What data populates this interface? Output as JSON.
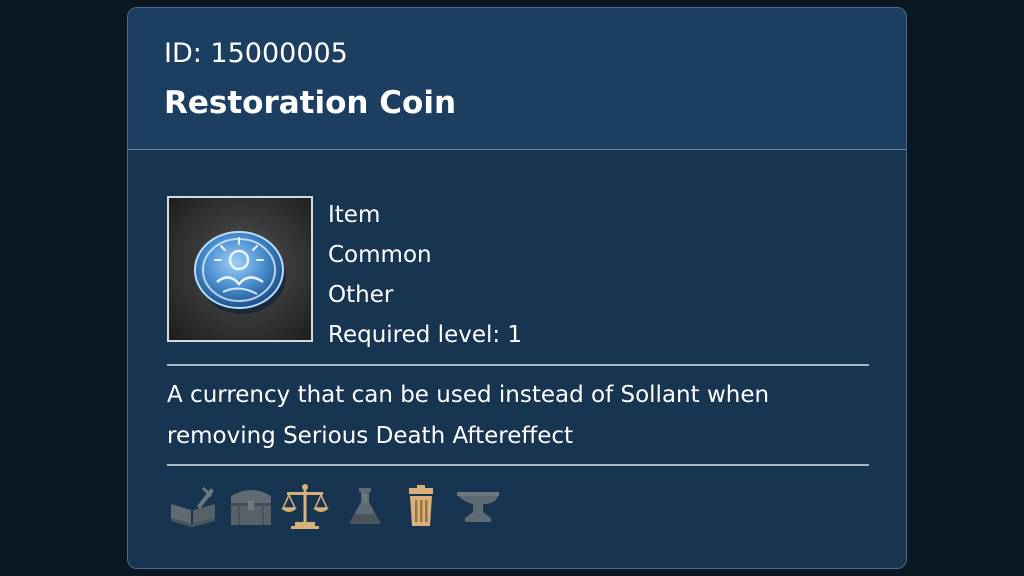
{
  "item": {
    "id_text": "ID: 15000005",
    "name": "Restoration Coin",
    "icon": "restoration-coin-icon",
    "properties": {
      "type": "Item",
      "rarity": "Common",
      "category": "Other",
      "required_level": "Required level: 1"
    },
    "description": "A currency that can be used instead of Sollant when removing Serious Death Aftereffect"
  },
  "actions": [
    {
      "icon": "crafting-book-icon",
      "enabled": false
    },
    {
      "icon": "storage-chest-icon",
      "enabled": false
    },
    {
      "icon": "trade-scales-icon",
      "enabled": true
    },
    {
      "icon": "alchemy-flask-icon",
      "enabled": false
    },
    {
      "icon": "trash-can-icon",
      "enabled": true
    },
    {
      "icon": "anvil-icon",
      "enabled": false
    }
  ],
  "colors": {
    "background": "#0c1724",
    "card": "#173450",
    "header": "#1c3e61",
    "text": "#ffffff",
    "action_enabled": "#d9b07a",
    "action_disabled": "#5f6a73"
  }
}
